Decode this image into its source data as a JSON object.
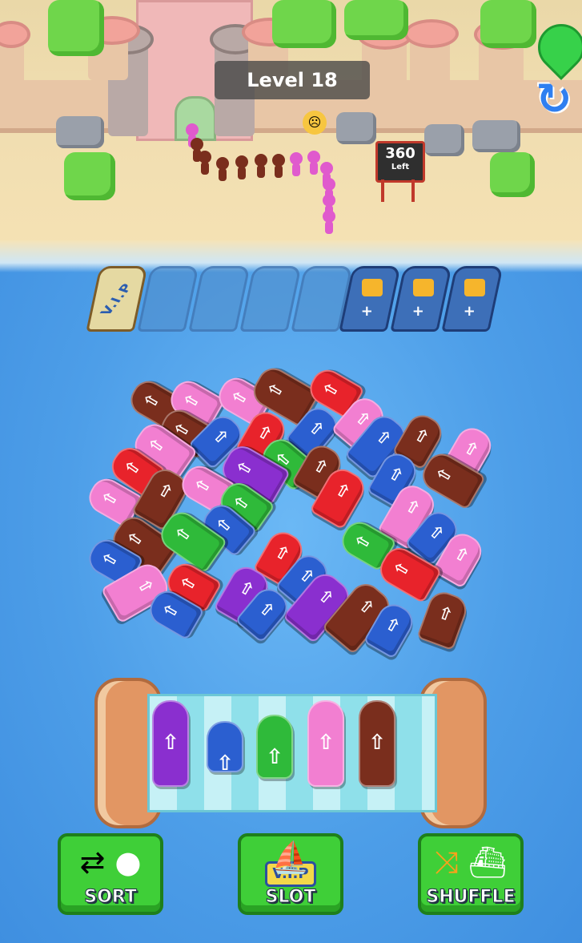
{
  "hud": {
    "level_label": "Level 18",
    "passengers_left_count": "360",
    "passengers_left_label": "Left"
  },
  "docks": {
    "vip_label": "V.I.P",
    "empty_count": 4,
    "locked_count": 3,
    "locked_plus": "+"
  },
  "conveyor": {
    "slots": [
      "purple",
      "blue",
      "green",
      "pink",
      "brown"
    ]
  },
  "powerups": {
    "sort_label": "SORT",
    "vip_slot_tag": "V.I.P",
    "vip_slot_label": "SLOT",
    "shuffle_label": "SHUFFLE"
  },
  "colors": {
    "red": "#e8232b",
    "pink": "#f27fd1",
    "brown": "#7a2e1d",
    "blue": "#2b5fd0",
    "green": "#2fba3a",
    "purple": "#8a2fcf"
  }
}
